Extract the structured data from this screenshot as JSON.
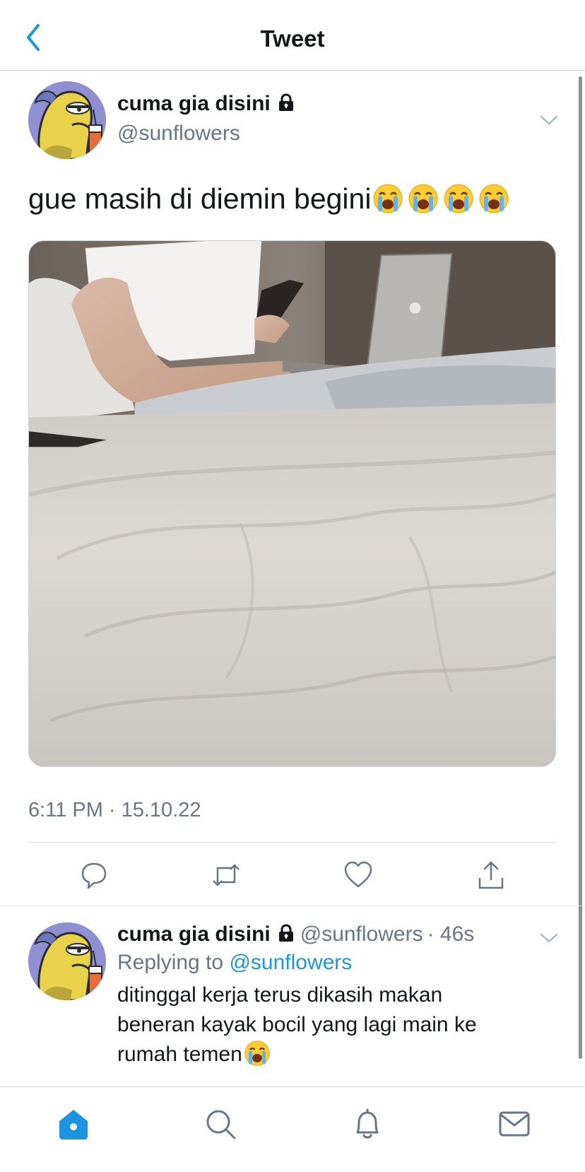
{
  "header": {
    "title": "Tweet",
    "back_icon": "chevron-left-icon"
  },
  "colors": {
    "accent": "#1b95e0",
    "text": "#14171a",
    "muted": "#657786"
  },
  "tweet": {
    "display_name": "cuma gia disini",
    "handle": "@sunflowers",
    "text": "gue masih di diemin begini",
    "emoji": [
      "loudly-crying-face",
      "loudly-crying-face",
      "loudly-crying-face",
      "loudly-crying-face"
    ],
    "timestamp": "6:11 PM · 15.10.22",
    "actions": [
      "reply-icon",
      "retweet-icon",
      "like-icon",
      "share-icon"
    ]
  },
  "reply": {
    "display_name": "cuma gia disini",
    "handle": "@sunflowers",
    "time": "· 46s",
    "replying_prefix": "Replying to",
    "replying_to": "@sunflowers",
    "text": "ditinggal kerja terus dikasih makan beneran kayak bocil yang lagi main ke rumah temen"
  },
  "tabbar": {
    "tabs": [
      "home-icon",
      "search-icon",
      "notifications-icon",
      "messages-icon"
    ],
    "active": "home-icon"
  }
}
